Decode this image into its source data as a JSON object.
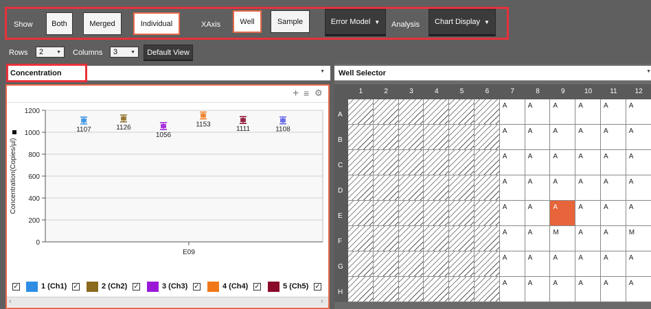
{
  "toolbar": {
    "show_label": "Show",
    "both": "Both",
    "merged": "Merged",
    "individual": "Individual",
    "xaxis_label": "XAxis",
    "well": "Well",
    "sample": "Sample",
    "error_model": "Error Model",
    "analysis": "Analysis",
    "chart_display": "Chart Display"
  },
  "layout_bar": {
    "rows_label": "Rows",
    "rows_value": "2",
    "columns_label": "Columns",
    "columns_value": "3",
    "default_view": "Default View"
  },
  "left_panel": {
    "selector_value": "Concentration",
    "toolbar_icons": [
      "plus-icon",
      "menu-icon",
      "gear-icon"
    ]
  },
  "chart_data": {
    "type": "scatter",
    "ylabel": "Concentration(Copies/µl)",
    "ylim": [
      0,
      1200
    ],
    "yticks": [
      "0",
      "200",
      "400",
      "600",
      "800",
      "1000",
      "1200"
    ],
    "categories": [
      "E09"
    ],
    "series": [
      {
        "name": "1 (Ch1)",
        "color": "#2e8de3",
        "value": 1107,
        "label": "1107"
      },
      {
        "name": "2 (Ch2)",
        "color": "#8b6a1e",
        "value": 1126,
        "label": "1126"
      },
      {
        "name": "3 (Ch3)",
        "color": "#9b19d6",
        "value": 1056,
        "label": "1056"
      },
      {
        "name": "4 (Ch4)",
        "color": "#f07818",
        "value": 1153,
        "label": "1153"
      },
      {
        "name": "5 (Ch5)",
        "color": "#8a0a2a",
        "value": 1111,
        "label": "1111"
      },
      {
        "name": "",
        "color": "#5a5ce6",
        "value": 1108,
        "label": "1108"
      }
    ],
    "legend": [
      {
        "label": "1 (Ch1)",
        "color": "#2e8de3"
      },
      {
        "label": "2 (Ch2)",
        "color": "#8b6a1e"
      },
      {
        "label": "3 (Ch3)",
        "color": "#9b19d6"
      },
      {
        "label": "4 (Ch4)",
        "color": "#f07818"
      },
      {
        "label": "5 (Ch5)",
        "color": "#8a0a2a"
      }
    ]
  },
  "well_selector": {
    "title": "Well Selector",
    "columns": [
      "1",
      "2",
      "3",
      "4",
      "5",
      "6",
      "7",
      "8",
      "9",
      "10",
      "11",
      "12"
    ],
    "rows": [
      {
        "label": "A",
        "cells": [
          "",
          "",
          "",
          "",
          "",
          "",
          "A",
          "A",
          "A",
          "A",
          "A",
          "A"
        ]
      },
      {
        "label": "B",
        "cells": [
          "",
          "",
          "",
          "",
          "",
          "",
          "A",
          "A",
          "A",
          "A",
          "A",
          "A"
        ]
      },
      {
        "label": "C",
        "cells": [
          "",
          "",
          "",
          "",
          "",
          "",
          "A",
          "A",
          "A",
          "A",
          "A",
          "A"
        ]
      },
      {
        "label": "D",
        "cells": [
          "",
          "",
          "",
          "",
          "",
          "",
          "A",
          "A",
          "A",
          "A",
          "A",
          "A"
        ]
      },
      {
        "label": "E",
        "cells": [
          "",
          "",
          "",
          "",
          "",
          "",
          "A",
          "A",
          "A",
          "A",
          "A",
          "A"
        ]
      },
      {
        "label": "F",
        "cells": [
          "",
          "",
          "",
          "",
          "",
          "",
          "A",
          "A",
          "M",
          "A",
          "A",
          "M"
        ]
      },
      {
        "label": "G",
        "cells": [
          "",
          "",
          "",
          "",
          "",
          "",
          "A",
          "A",
          "A",
          "A",
          "A",
          "A"
        ]
      },
      {
        "label": "H",
        "cells": [
          "",
          "",
          "",
          "",
          "",
          "",
          "A",
          "A",
          "A",
          "A",
          "A",
          "A"
        ]
      }
    ],
    "selected_well": "E9",
    "accent": "#e8643a"
  }
}
